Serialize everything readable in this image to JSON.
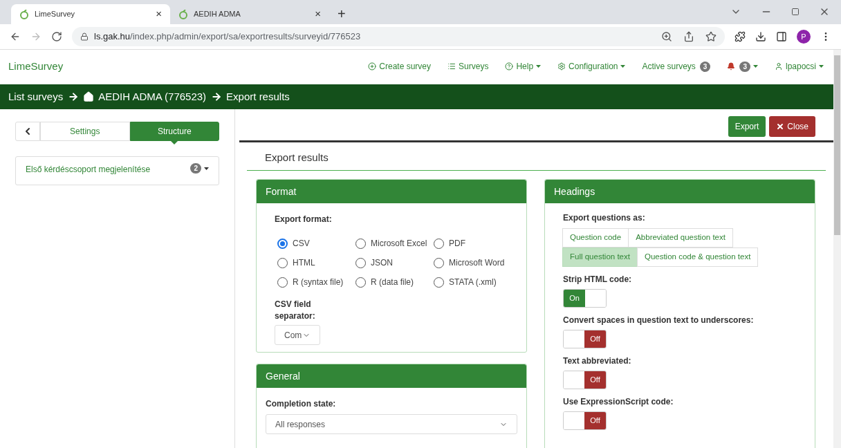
{
  "browser": {
    "tabs": [
      {
        "title": "LimeSurvey",
        "close": "×",
        "selected": true
      },
      {
        "title": "AEDIH ADMA",
        "close": "×",
        "selected": false
      }
    ],
    "new_tab": "+",
    "url_host": "ls.gak.hu",
    "url_path": "/index.php/admin/export/sa/exportresults/surveyid/776523",
    "profile": "P"
  },
  "navbar": {
    "brand": "LimeSurvey",
    "items": [
      {
        "kind": "plus",
        "label": "Create survey"
      },
      {
        "kind": "list",
        "label": "Surveys"
      },
      {
        "kind": "help",
        "label": "Help",
        "caret": true
      },
      {
        "kind": "cogs",
        "label": "Configuration",
        "caret": true
      },
      {
        "kind": "plain",
        "label": "Active surveys",
        "badge": "3"
      },
      {
        "kind": "bell",
        "badge": "3",
        "caret": true
      },
      {
        "kind": "user",
        "label": "lpapocsi",
        "caret": true
      }
    ]
  },
  "breadcrumb": [
    {
      "kind": "plain",
      "label": "List surveys"
    },
    {
      "kind": "home",
      "label": "AEDIH ADMA (776523)"
    },
    {
      "kind": "plain",
      "label": "Export results"
    }
  ],
  "sidebar": {
    "tabs": [
      {
        "label": "Settings",
        "selected": false
      },
      {
        "label": "Structure",
        "selected": true
      }
    ],
    "groups": [
      {
        "label": "Első kérdéscsoport megjelenítése",
        "count": "2"
      }
    ]
  },
  "toolbar": {
    "export": "Export",
    "close": "Close"
  },
  "heading": "Export results",
  "format": {
    "title": "Format",
    "label": "Export format:",
    "options": [
      {
        "label": "CSV",
        "selected": true
      },
      {
        "label": "Microsoft Excel",
        "selected": false
      },
      {
        "label": "PDF",
        "selected": false
      },
      {
        "label": "HTML",
        "selected": false
      },
      {
        "label": "JSON",
        "selected": false
      },
      {
        "label": "Microsoft Word",
        "selected": false
      },
      {
        "label": "R (syntax file)",
        "selected": false
      },
      {
        "label": "R (data file)",
        "selected": false
      },
      {
        "label": "STATA (.xml)",
        "selected": false
      }
    ],
    "separator_label": "CSV field separator:",
    "separator_value": "Com"
  },
  "general": {
    "title": "General",
    "completion_label": "Completion state:",
    "completion_value": "All responses"
  },
  "headings": {
    "title": "Headings",
    "label": "Export questions as:",
    "options": [
      {
        "label": "Question code",
        "selected": false
      },
      {
        "label": "Abbreviated question text",
        "selected": false
      },
      {
        "label": "Full question text",
        "selected": true
      },
      {
        "label": "Question code & question text",
        "selected": false
      }
    ],
    "toggles": [
      {
        "label": "Strip HTML code:",
        "on": true,
        "text": "On"
      },
      {
        "label": "Convert spaces in question text to underscores:",
        "on": false,
        "text": "Off"
      },
      {
        "label": "Text abbreviated:",
        "on": false,
        "text": "Off"
      },
      {
        "label": "Use ExpressionScript code:",
        "on": false,
        "text": "Off"
      }
    ]
  }
}
